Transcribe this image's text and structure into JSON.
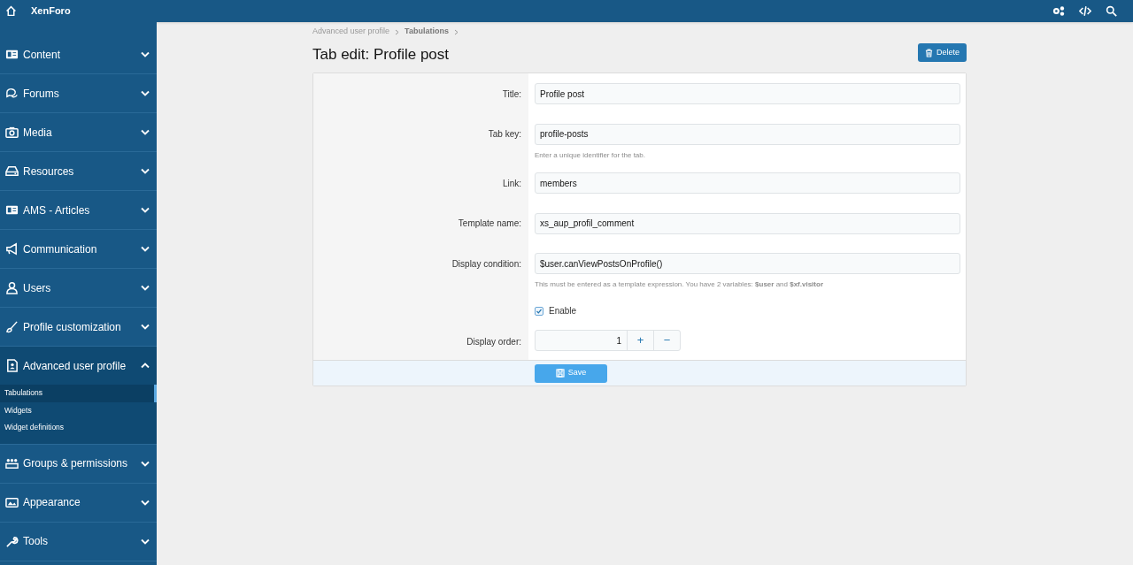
{
  "header": {
    "title": "XenForo"
  },
  "sidebar": {
    "items": [
      {
        "label": "Content",
        "expanded": false
      },
      {
        "label": "Forums",
        "expanded": false
      },
      {
        "label": "Media",
        "expanded": false
      },
      {
        "label": "Resources",
        "expanded": false
      },
      {
        "label": "AMS - Articles",
        "expanded": false
      },
      {
        "label": "Communication",
        "expanded": false
      },
      {
        "label": "Users",
        "expanded": false
      },
      {
        "label": "Profile customization",
        "expanded": false
      },
      {
        "label": "Advanced user profile",
        "expanded": true,
        "children": [
          {
            "label": "Tabulations",
            "selected": true
          },
          {
            "label": "Widgets",
            "selected": false
          },
          {
            "label": "Widget definitions",
            "selected": false
          }
        ]
      },
      {
        "label": "Groups & permissions",
        "expanded": false
      },
      {
        "label": "Appearance",
        "expanded": false
      },
      {
        "label": "Tools",
        "expanded": false
      }
    ]
  },
  "breadcrumb": [
    {
      "label": "Advanced user profile",
      "current": false
    },
    {
      "label": "Tabulations",
      "current": true
    }
  ],
  "page_title": "Tab edit: Profile post",
  "delete_button": "Delete",
  "form": [
    {
      "kind": "text",
      "label": "Title:",
      "value": "Profile post"
    },
    {
      "kind": "text",
      "label": "Tab key:",
      "value": "profile-posts",
      "hint": "Enter a unique identifier for the tab."
    },
    {
      "kind": "text",
      "label": "Link:",
      "value": "members"
    },
    {
      "kind": "text",
      "label": "Template name:",
      "value": "xs_aup_profil_comment"
    },
    {
      "kind": "text",
      "label": "Display condition:",
      "value": "$user.canViewPostsOnProfile()",
      "hint": "This must be entered as a template expression. You have 2 variables: **$user** and **$xf.visitor**"
    },
    {
      "kind": "checkbox",
      "label": "Enable",
      "checked": true
    },
    {
      "kind": "number",
      "label": "Display order:",
      "value": "1",
      "plus": "+",
      "minus": "−"
    }
  ],
  "save_button": "Save"
}
